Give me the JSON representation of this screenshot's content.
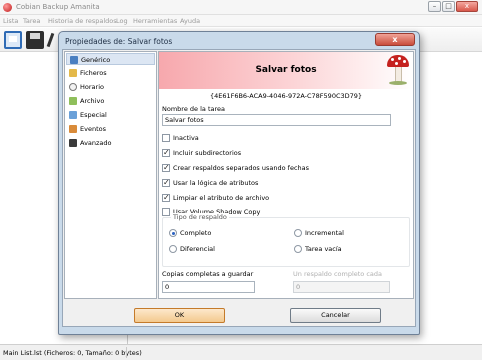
{
  "app": {
    "title": "Cobian Backup Amanita",
    "window_controls": {
      "minimize": "–",
      "maximize": "□",
      "close": "x"
    }
  },
  "menu": [
    "Lista",
    "Tarea",
    "Historia de respaldos",
    "Log",
    "Herramientas",
    "Ayuda"
  ],
  "toolbar": {
    "icons": [
      "new-list-icon",
      "save-icon",
      "cut-icon"
    ]
  },
  "status": {
    "text": "Main List.lst (Ficheros: 0, Tamaño: 0 bytes)"
  },
  "dialog": {
    "title": "Propiedades de: Salvar fotos",
    "close": "x",
    "nav": [
      {
        "label": "Genérico",
        "icon": "generic-icon",
        "selected": true
      },
      {
        "label": "Ficheros",
        "icon": "files-icon",
        "selected": false
      },
      {
        "label": "Horario",
        "icon": "schedule-icon",
        "selected": false
      },
      {
        "label": "Archivo",
        "icon": "archive-icon",
        "selected": false
      },
      {
        "label": "Especial",
        "icon": "special-icon",
        "selected": false
      },
      {
        "label": "Eventos",
        "icon": "events-icon",
        "selected": false
      },
      {
        "label": "Avanzado",
        "icon": "advanced-icon",
        "selected": false
      }
    ],
    "banner_title": "Salvar fotos",
    "guid": "{4E61F6B6-ACA9-4046-972A-C78F590C3D79}",
    "task_name_label": "Nombre de la tarea",
    "task_name_value": "Salvar fotos",
    "checkboxes": [
      {
        "label": "Inactiva",
        "checked": false
      },
      {
        "label": "Incluir subdirectorios",
        "checked": true
      },
      {
        "label": "Crear respaldos separados usando fechas",
        "checked": true
      },
      {
        "label": "Usar la lógica de atributos",
        "checked": true
      },
      {
        "label": "Limpiar el atributo de archivo",
        "checked": true
      },
      {
        "label": "Usar Volume Shadow Copy",
        "checked": false
      }
    ],
    "backup_type": {
      "title": "Tipo de respaldo",
      "options": [
        {
          "label": "Completo",
          "selected": true
        },
        {
          "label": "Incremental",
          "selected": false
        },
        {
          "label": "Diferencial",
          "selected": false
        },
        {
          "label": "Tarea vacía",
          "selected": false
        }
      ]
    },
    "full_copies_label": "Copias completas a guardar",
    "full_copies_value": "0",
    "full_every_label": "Un respaldo completo cada",
    "full_every_value": "0",
    "ok": "OK",
    "cancel": "Cancelar"
  }
}
